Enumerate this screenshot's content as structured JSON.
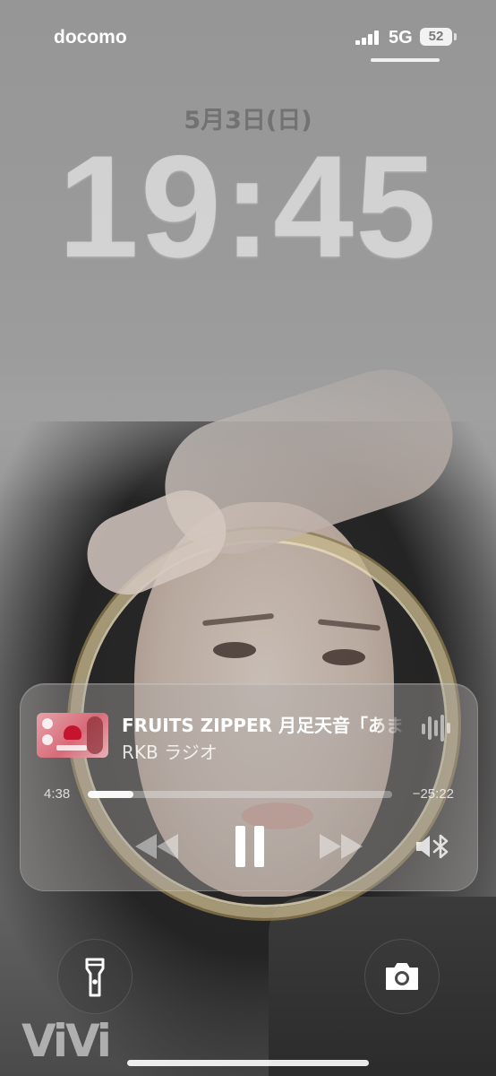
{
  "status_bar": {
    "carrier": "docomo",
    "network": "5G",
    "battery_level": "52",
    "signal_bars": 4
  },
  "lock_screen": {
    "date": "5月3日(日)",
    "time": "19:45"
  },
  "now_playing": {
    "title": "FRUITS ZIPPER 月足天音「あま",
    "subtitle": "RKB ラジオ",
    "elapsed": "4:38",
    "remaining": "−25:22",
    "progress_fraction": 0.15,
    "artwork_text": "21:30-24:00",
    "controls": {
      "rewind_icon": "rewind-icon",
      "pause_icon": "pause-icon",
      "forward_icon": "fast-forward-icon",
      "output_icon": "speaker-bluetooth-icon"
    }
  },
  "quick_actions": {
    "left_icon": "flashlight-icon",
    "right_icon": "camera-icon"
  },
  "wallpaper": {
    "watermark": "ViVi"
  },
  "colors": {
    "text_primary": "#ffffff",
    "widget_bg": "rgba(175,170,168,0.42)"
  }
}
